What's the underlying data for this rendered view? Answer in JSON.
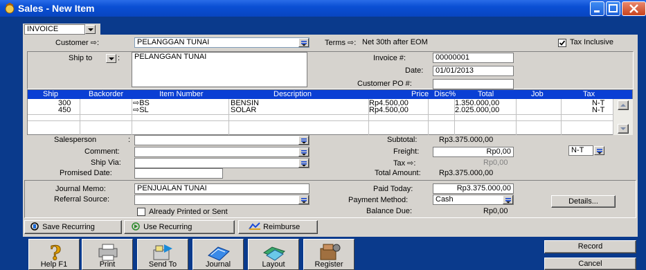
{
  "window": {
    "title": "Sales - New Item",
    "controls": [
      "minimize",
      "maximize",
      "close"
    ]
  },
  "layout_select": {
    "value": "INVOICE"
  },
  "header": {
    "customer_label": "Customer ⇨:",
    "customer_value": "PELANGGAN TUNAI",
    "terms_label": "Terms ⇨:",
    "terms_value": "Net 30th after EOM",
    "tax_inclusive_label": "Tax Inclusive",
    "tax_inclusive_checked": true
  },
  "ship_to": {
    "label": "Ship to",
    "address": "PELANGGAN TUNAI"
  },
  "invoice": {
    "number_label": "Invoice #:",
    "number_value": "00000001",
    "date_label": "Date:",
    "date_value": "01/01/2013",
    "customer_po_label": "Customer PO #:",
    "customer_po_value": ""
  },
  "table": {
    "columns": [
      "Ship",
      "Backorder",
      "Item Number",
      "Description",
      "Price",
      "Disc%",
      "Total",
      "Job",
      "Tax"
    ],
    "rows": [
      {
        "ship": "300",
        "backorder": "",
        "item": "⇨BS",
        "description": "BENSIN",
        "price": "Rp4.500,00",
        "disc": "",
        "total": "1.350.000,00",
        "job": "",
        "tax": "N-T"
      },
      {
        "ship": "450",
        "backorder": "",
        "item": "⇨SL",
        "description": "SOLAR",
        "price": "Rp4.500,00",
        "disc": "",
        "total": "2.025.000,00",
        "job": "",
        "tax": "N-T"
      }
    ]
  },
  "details": {
    "salesperson_label": "Salesperson",
    "salesperson_value": "",
    "comment_label": "Comment:",
    "comment_value": "",
    "ship_via_label": "Ship Via:",
    "ship_via_value": "",
    "promised_date_label": "Promised Date:",
    "promised_date_value": ""
  },
  "totals": {
    "subtotal_label": "Subtotal:",
    "subtotal_value": "Rp3.375.000,00",
    "freight_label": "Freight:",
    "freight_value": "Rp0,00",
    "freight_tax": "N-T",
    "tax_label": "Tax ⇨:",
    "tax_value": "Rp0,00",
    "total_label": "Total Amount:",
    "total_value": "Rp3.375.000,00"
  },
  "payment": {
    "journal_memo_label": "Journal Memo:",
    "journal_memo_value": "PENJUALAN TUNAI",
    "referral_source_label": "Referral Source:",
    "referral_source_value": "",
    "already_printed_label": "Already Printed or Sent",
    "paid_today_label": "Paid Today:",
    "paid_today_value": "Rp3.375.000,00",
    "payment_method_label": "Payment Method:",
    "payment_method_value": "Cash",
    "balance_due_label": "Balance Due:",
    "balance_due_value": "Rp0,00",
    "details_button": "Details..."
  },
  "recurring": {
    "save_label": "Save Recurring",
    "use_label": "Use Recurring",
    "reimburse_label": "Reimburse"
  },
  "toolbar": {
    "help": "Help F1",
    "print": "Print",
    "send_to": "Send To",
    "journal": "Journal",
    "layout": "Layout",
    "register": "Register"
  },
  "actions": {
    "record": "Record",
    "cancel": "Cancel"
  },
  "colors": {
    "title_blue": "#0a4fd4",
    "header_row_blue": "#0a3fd4",
    "panel_gray": "#d6d3ce",
    "background_blue": "#0a3a8c"
  }
}
